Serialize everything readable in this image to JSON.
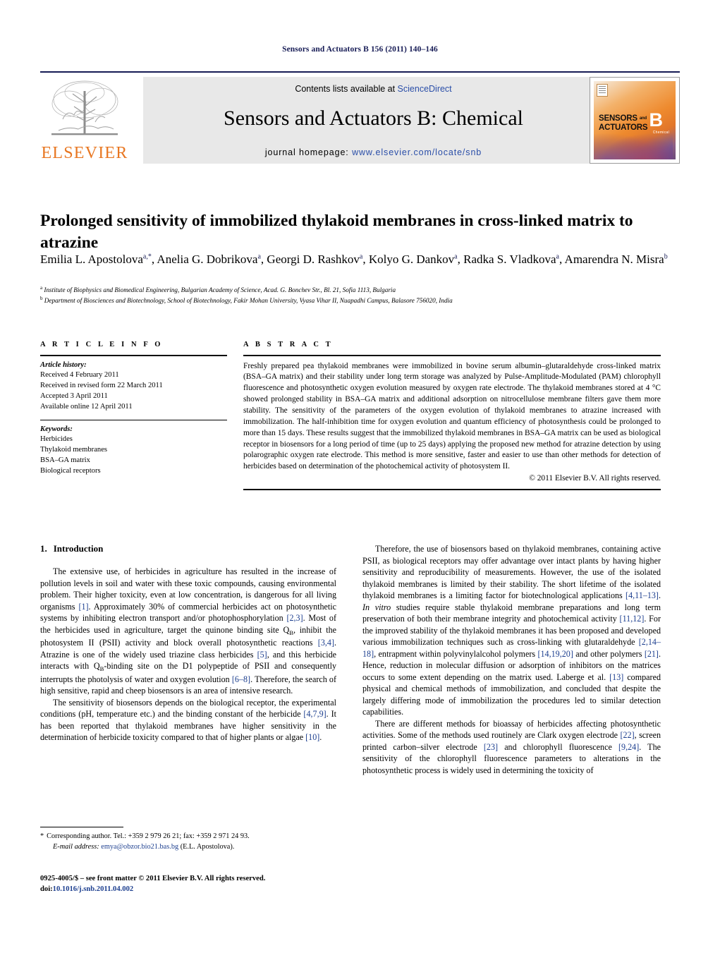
{
  "running_head": "Sensors and Actuators B 156 (2011) 140–146",
  "masthead": {
    "contents_prefix": "Contents lists available at ",
    "sciencedirect": "ScienceDirect",
    "journal_title": "Sensors and Actuators B: Chemical",
    "homepage_prefix": "journal homepage: ",
    "homepage_url": "www.elsevier.com/locate/snb",
    "publisher": "ELSEVIER",
    "cover": {
      "line1": "SENSORS",
      "and": "and",
      "line2": "ACTUATORS",
      "letter": "B",
      "sub": "Chemical"
    },
    "accent_color": "#2a4ea8",
    "elsevier_orange": "#e87722",
    "rule_color": "#161b55"
  },
  "article": {
    "title": "Prolonged sensitivity of immobilized thylakoid membranes in cross-linked matrix to atrazine",
    "authors_line1_pre": "Emilia L. Apostolova",
    "authors_html": "Emilia L. Apostolova<sup>a,*</sup>, Anelia G. Dobrikova<sup>a</sup>, Georgi D. Rashkov<sup>a</sup>, Kolyo G. Dankov<sup>a</sup>, Radka S. Vladkova<sup>a</sup>, Amarendra N. Misra<sup>b</sup>",
    "affiliation_a": "Institute of Biophysics and Biomedical Engineering, Bulgarian Academy of Science, Acad. G. Bonchev Str., Bl. 21, Sofia 1113, Bulgaria",
    "affiliation_b": "Department of Biosciences and Biotechnology, School of Biotechnology, Fakir Mohan University, Vyasa Vihar II, Nuapadhi Campus, Balasore 756020, India"
  },
  "article_info": {
    "heading": "A R T I C L E   I N F O",
    "history_label": "Article history:",
    "history": [
      "Received 4 February 2011",
      "Received in revised form 22 March 2011",
      "Accepted 3 April 2011",
      "Available online 12 April 2011"
    ],
    "keywords_label": "Keywords:",
    "keywords": [
      "Herbicides",
      "Thylakoid membranes",
      "BSA–GA matrix",
      "Biological receptors"
    ]
  },
  "abstract": {
    "heading": "A B S T R A C T",
    "text": "Freshly prepared pea thylakoid membranes were immobilized in bovine serum albumin–glutaraldehyde cross-linked matrix (BSA–GA matrix) and their stability under long term storage was analyzed by Pulse-Amplitude-Modulated (PAM) chlorophyll fluorescence and photosynthetic oxygen evolution measured by oxygen rate electrode. The thylakoid membranes stored at 4 °C showed prolonged stability in BSA–GA matrix and additional adsorption on nitrocellulose membrane filters gave them more stability. The sensitivity of the parameters of the oxygen evolution of thylakoid membranes to atrazine increased with immobilization. The half-inhibition time for oxygen evolution and quantum efficiency of photosynthesis could be prolonged to more than 15 days. These results suggest that the immobilized thylakoid membranes in BSA–GA matrix can be used as biological receptor in biosensors for a long period of time (up to 25 days) applying the proposed new method for atrazine detection by using polarographic oxygen rate electrode. This method is more sensitive, faster and easier to use than other methods for detection of herbicides based on determination of the photochemical activity of photosystem II.",
    "copyright": "© 2011 Elsevier B.V. All rights reserved."
  },
  "body": {
    "section_number": "1.",
    "section_title": "Introduction",
    "left_paragraphs": [
      "The extensive use, of herbicides in agriculture has resulted in the increase of pollution levels in soil and water with these toxic compounds, causing environmental problem. Their higher toxicity, even at low concentration, is dangerous for all living organisms [1]. Approximately 30% of commercial herbicides act on photosynthetic systems by inhibiting electron transport and/or photophosphorylation [2,3]. Most of the herbicides used in agriculture, target the quinone binding site QB, inhibit the photosystem II (PSII) activity and block overall photosynthetic reactions [3,4]. Atrazine is one of the widely used triazine class herbicides [5], and this herbicide interacts with QB-binding site on the D1 polypeptide of PSII and consequently interrupts the photolysis of water and oxygen evolution [6–8]. Therefore, the search of high sensitive, rapid and cheep biosensors is an area of intensive research.",
      "The sensitivity of biosensors depends on the biological receptor, the experimental conditions (pH, temperature etc.) and the binding constant of the herbicide [4,7,9]. It has been reported that thylakoid membranes have higher sensitivity in the determination of herbicide toxicity compared to that of higher plants or algae [10]."
    ],
    "right_paragraphs": [
      "Therefore, the use of biosensors based on thylakoid membranes, containing active PSII, as biological receptors may offer advantage over intact plants by having higher sensitivity and reproducibility of measurements. However, the use of the isolated thylakoid membranes is limited by their stability. The short lifetime of the isolated thylakoid membranes is a limiting factor for biotechnological applications [4,11–13]. In vitro studies require stable thylakoid membrane preparations and long term preservation of both their membrane integrity and photochemical activity [11,12]. For the improved stability of the thylakoid membranes it has been proposed and developed various immobilization techniques such as cross-linking with glutaraldehyde [2,14–18], entrapment within polyvinylalcohol polymers [14,19,20] and other polymers [21]. Hence, reduction in molecular diffusion or adsorption of inhibitors on the matrices occurs to some extent depending on the matrix used. Laberge et al. [13] compared physical and chemical methods of immobilization, and concluded that despite the largely differing mode of immobilization the procedures led to similar detection capabilities.",
      "There are different methods for bioassay of herbicides affecting photosynthetic activities. Some of the methods used routinely are Clark oxygen electrode [22], screen printed carbon–silver electrode [23] and chlorophyll fluorescence [9,24]. The sensitivity of the chlorophyll fluorescence parameters to alterations in the photosynthetic process is widely used in determining the toxicity of"
    ]
  },
  "footnote": {
    "corresponding": "Corresponding author. Tel.: +359 2 979 26 21; fax: +359 2 971 24 93.",
    "email_label": "E-mail address:",
    "email": "emya@obzor.bio21.bas.bg",
    "email_attribution": "(E.L. Apostolova).",
    "star": "*"
  },
  "imprint": {
    "front_matter": "0925-4005/$ – see front matter © 2011 Elsevier B.V. All rights reserved.",
    "doi_label": "doi:",
    "doi": "10.1016/j.snb.2011.04.002"
  }
}
